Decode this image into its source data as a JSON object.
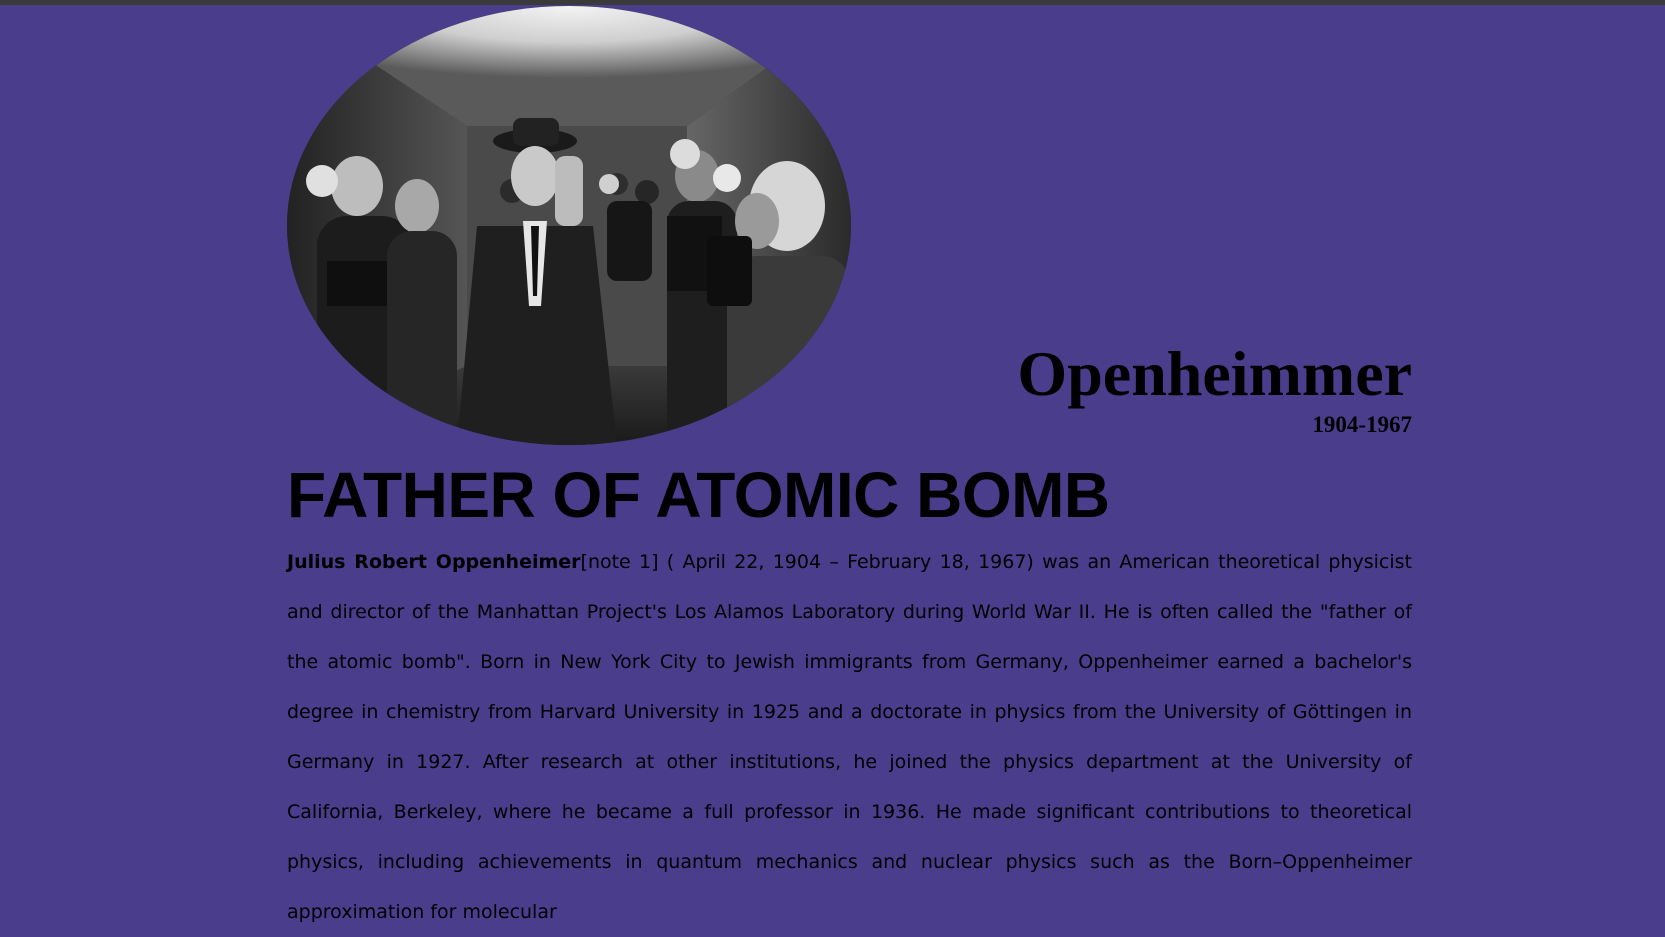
{
  "page": {
    "image_alt": "Oppenheimer surrounded by press photographers",
    "name": "Openheimmer",
    "years": "1904-1967",
    "headline": "FATHER OF ATOMIC BOMB",
    "bio_name": "Julius Robert Oppenheimer",
    "bio_text": "[note 1] ( April 22, 1904 – February 18, 1967) was an American theoretical physicist and director of the Manhattan Project's Los Alamos Laboratory during World War II. He is often called the \"father of the atomic bomb\". Born in New York City to Jewish immigrants from Germany, Oppenheimer earned a bachelor's degree in chemistry from Harvard University in 1925 and a doctorate in physics from the University of Göttingen in Germany in 1927. After research at other institutions, he joined the physics department at the University of California, Berkeley, where he became a full professor in 1936. He made significant contributions to theoretical physics, including achievements in quantum mechanics and nuclear physics such as the Born–Oppenheimer approximation for molecular"
  },
  "colors": {
    "background": "#493d8c",
    "text": "#000000",
    "topbar": "#3a3a3a"
  }
}
